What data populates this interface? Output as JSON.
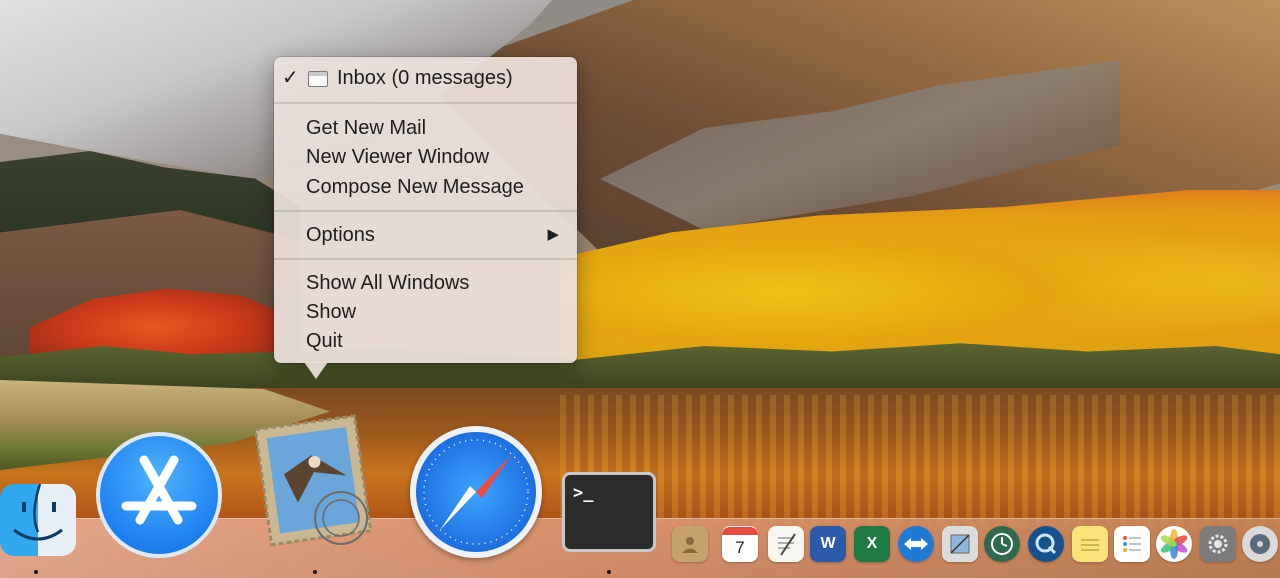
{
  "menu": {
    "header_item": {
      "label": "Inbox (0 messages)",
      "checked": true,
      "icon": "window-icon"
    },
    "group1": [
      "Get New Mail",
      "New Viewer Window",
      "Compose New Message"
    ],
    "options": {
      "label": "Options",
      "has_submenu": true
    },
    "group3": [
      "Show All Windows",
      "Show",
      "Quit"
    ],
    "check_glyph": "✓",
    "submenu_glyph": "▶"
  },
  "dock": {
    "terminal_prompt": ">_",
    "calendar_day": "7",
    "word_letter": "W",
    "excel_letter": "X",
    "large_icons": [
      "finder-icon",
      "app-store-icon",
      "mail-icon",
      "safari-icon",
      "terminal-icon"
    ],
    "small_icons": [
      "contacts-icon",
      "calendar-icon",
      "textedit-icon",
      "word-icon",
      "excel-icon",
      "teamviewer-icon",
      "preview-icon",
      "time-machine-icon",
      "quicktime-icon",
      "notes-icon",
      "reminders-icon",
      "photos-icon",
      "system-preferences-icon",
      "disk-utility-icon"
    ],
    "running_apps": [
      "finder-icon",
      "mail-icon",
      "terminal-icon"
    ]
  }
}
